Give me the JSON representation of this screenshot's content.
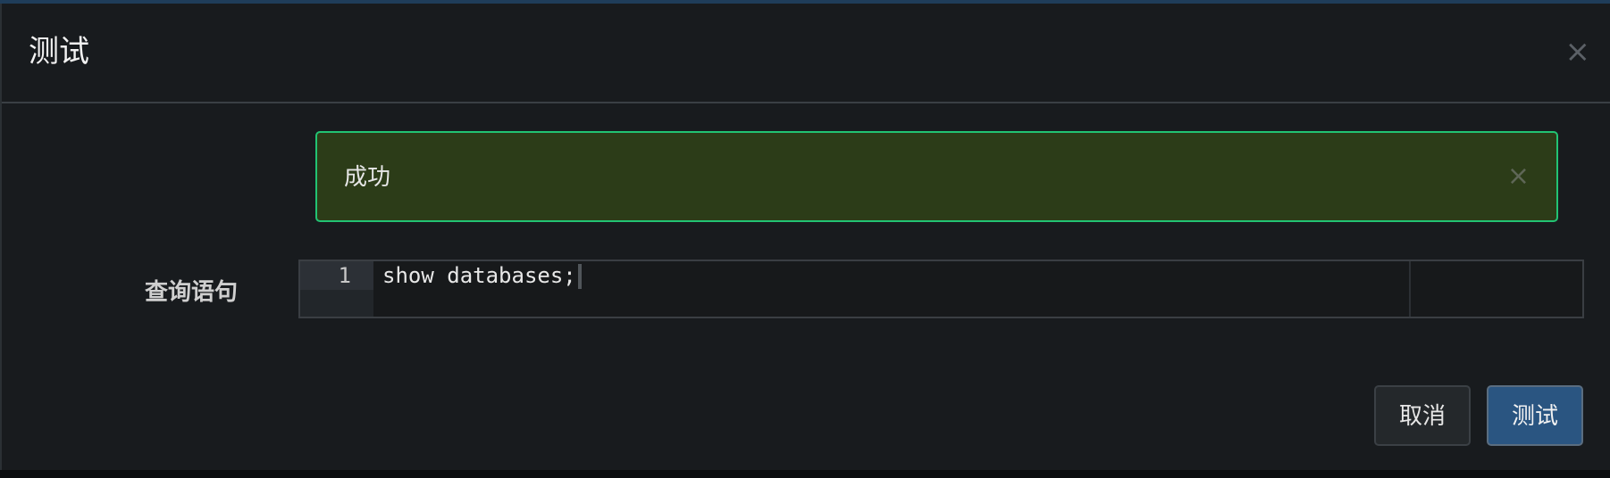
{
  "dialog": {
    "title": "测试",
    "close_glyph": "×"
  },
  "alert": {
    "message": "成功",
    "close_glyph": "×",
    "status": "success"
  },
  "form": {
    "query_label": "查询语句",
    "editor": {
      "line_number": "1",
      "code": "show databases;"
    }
  },
  "footer": {
    "cancel_label": "取消",
    "test_label": "测试"
  },
  "colors": {
    "success_border": "#22c373",
    "success_bg": "#2c3c18",
    "primary_button": "#2a5581"
  },
  "icons": {
    "dialog_close": "close-icon",
    "alert_close": "close-icon"
  }
}
